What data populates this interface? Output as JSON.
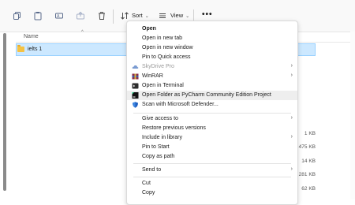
{
  "toolbar": {
    "sort_label": "Sort",
    "view_label": "View",
    "more_label": "•••"
  },
  "file_list": {
    "column_name": "Name",
    "selected_item": "ielts 1",
    "sizes": [
      "1 KB",
      "475 KB",
      "14 KB",
      "281 KB",
      "62 KB"
    ]
  },
  "context_menu": {
    "items": [
      {
        "label": "Open",
        "bold": true
      },
      {
        "label": "Open in new tab"
      },
      {
        "label": "Open in new window"
      },
      {
        "label": "Pin to Quick access"
      },
      {
        "label": "SkyDrive Pro",
        "disabled": true,
        "submenu": true,
        "icon": "skydrive-icon"
      },
      {
        "label": "WinRAR",
        "submenu": true,
        "icon": "winrar-icon"
      },
      {
        "label": "Open in Terminal",
        "icon": "terminal-icon"
      },
      {
        "label": "Open Folder as PyCharm Community Edition Project",
        "icon": "pycharm-icon"
      },
      {
        "label": "Scan with Microsoft Defender...",
        "icon": "defender-icon"
      },
      {
        "label": "Give access to",
        "submenu": true
      },
      {
        "label": "Restore previous versions"
      },
      {
        "label": "Include in library",
        "submenu": true
      },
      {
        "label": "Pin to Start"
      },
      {
        "label": "Copy as path"
      },
      {
        "label": "Send to",
        "submenu": true
      },
      {
        "label": "Cut"
      },
      {
        "label": "Copy"
      }
    ]
  },
  "colors": {
    "selection": "#cce8ff",
    "selection_border": "#99d1ff",
    "folder": "#f5c243",
    "hover": "#eeeeee"
  }
}
